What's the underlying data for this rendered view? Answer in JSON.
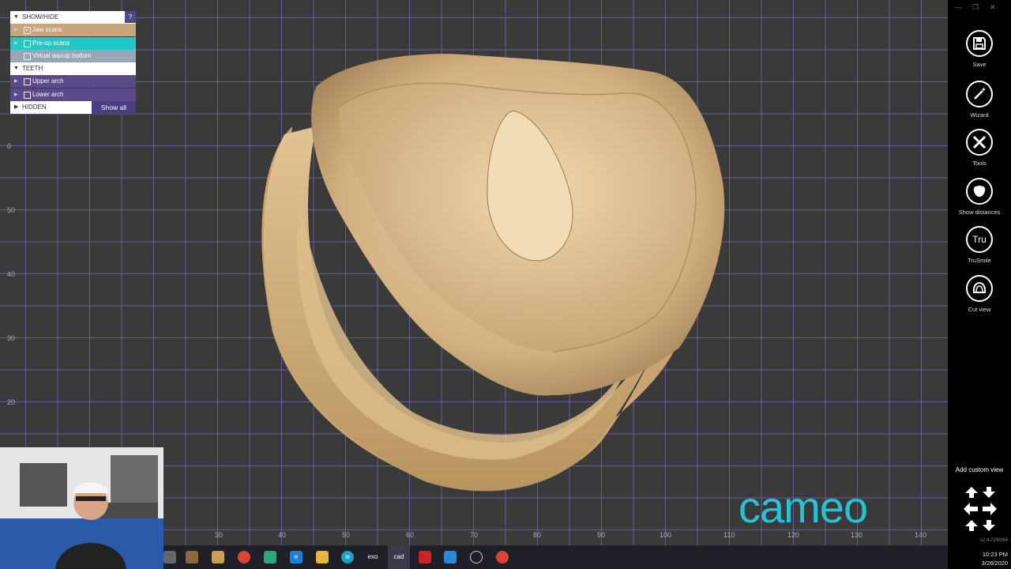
{
  "panel": {
    "show_hide_label": "SHOW/HIDE",
    "help_label": "?",
    "jaw_scans": "Jaw scans",
    "preop_scans": "Pre-op scans",
    "virtual_waxup": "Virtual waxup bottom",
    "teeth_label": "TEETH",
    "upper_arch": "Upper arch",
    "lower_arch": "Lower arch",
    "hidden_label": "HIDDEN",
    "show_all": "Show all"
  },
  "axis": {
    "x_ticks": [
      "30",
      "40",
      "50",
      "60",
      "70",
      "80",
      "90",
      "100",
      "110",
      "120",
      "130",
      "140"
    ],
    "y_ticks": [
      "0",
      "50",
      "40",
      "30",
      "20"
    ]
  },
  "toolbar": {
    "save": "Save",
    "wizard": "Wizard",
    "tools": "Tools",
    "show_distances": "Show distances",
    "trusmile": "TruSmile",
    "trusmile_icon_text": "Tru",
    "cut_view": "Cut view",
    "add_custom_view": "Add custom view",
    "version": "v2.4-7290/64"
  },
  "logo": {
    "text": "cameo"
  },
  "taskbar": {
    "exo_label": "exo",
    "cad_label": "cad",
    "time": "10:23 PM",
    "date": "3/28/2020"
  },
  "colors": {
    "model": "#dcbb8c",
    "grid": "#8c78dc",
    "accent_cyan": "#22c8c8",
    "panel_tan": "#c9a57a",
    "panel_purple": "#5a4a8a"
  }
}
